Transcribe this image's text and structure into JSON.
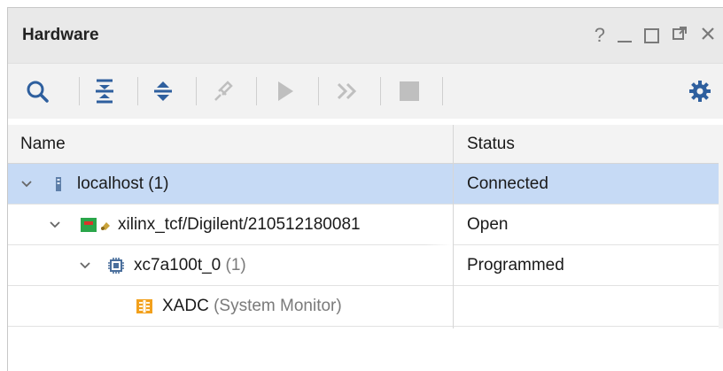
{
  "panel": {
    "title": "Hardware",
    "window_controls": [
      {
        "name": "help-icon",
        "glyph": "?"
      },
      {
        "name": "minimize-icon",
        "glyph": "—"
      },
      {
        "name": "maximize-icon",
        "glyph": "□"
      },
      {
        "name": "float-icon",
        "glyph": "⧉"
      },
      {
        "name": "close-icon",
        "glyph": "✕"
      }
    ]
  },
  "toolbar": {
    "icons": [
      "search-icon",
      "collapse-all-icon",
      "expand-all-icon",
      "auto-connect-icon",
      "run-trigger-icon",
      "run-trigger-immediate-icon",
      "stop-trigger-icon",
      "settings-icon"
    ]
  },
  "table": {
    "columns": [
      "Name",
      "Status"
    ],
    "rows": [
      {
        "label": "localhost",
        "count": "(1)",
        "status": "Connected",
        "icon": "server-icon",
        "selected": true
      },
      {
        "label": "xilinx_tcf/Digilent/210512180081",
        "count": "",
        "status": "Open",
        "icon": "board-icon",
        "selected": false
      },
      {
        "label": "xc7a100t_0",
        "count": "(1)",
        "status": "Programmed",
        "icon": "chip-icon",
        "selected": false
      },
      {
        "label": "XADC",
        "count": "(System Monitor)",
        "status": "",
        "icon": "xadc-icon",
        "selected": false
      }
    ]
  },
  "colors": {
    "selected_row": "#c6daf5",
    "toolbar_icon": "#2e5f9e",
    "toolbar_disabled": "#bfbfbf",
    "board_green": "#2aa64a",
    "board_red": "#d9342b",
    "xadc_orange": "#f2a01c"
  }
}
